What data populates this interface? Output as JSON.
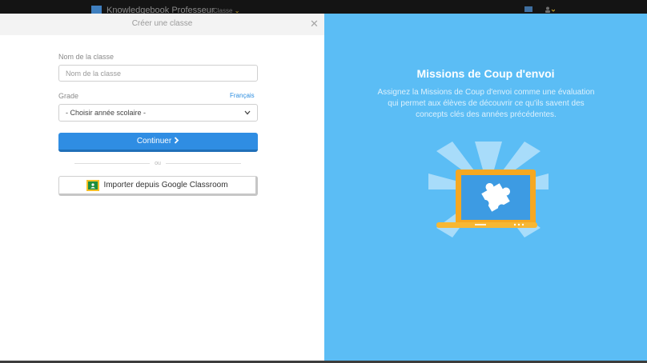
{
  "topbar": {
    "app_title": "Knowledgebook Professeur",
    "class_menu": "Classe",
    "class_menu_chevron": "⌄",
    "icons": [
      "cart-icon",
      "user-icon"
    ]
  },
  "modal": {
    "title": "Créer une classe",
    "close_icon": "close-icon",
    "form": {
      "class_name_label": "Nom de la classe",
      "class_name_placeholder": "Nom de la classe",
      "grade_label": "Grade",
      "language_link": "Français",
      "grade_select_value": "- Choisir année scolaire -",
      "continue_label": "Continuer",
      "or_label": "ou",
      "google_import_label": "Importer depuis Google Classroom"
    },
    "promo": {
      "heading": "Missions de Coup d'envoi",
      "description": "Assignez la Missions de Coup d'envoi comme une évaluation qui permet aux élèves de découvrir ce qu'ils savent des concepts clés des années précédentes.",
      "illustration": "laptop-puzzle-illustration"
    }
  },
  "colors": {
    "primary": "#2f8de3",
    "promo_bg": "#5bbdf5",
    "laptop_frame": "#f6a821"
  }
}
